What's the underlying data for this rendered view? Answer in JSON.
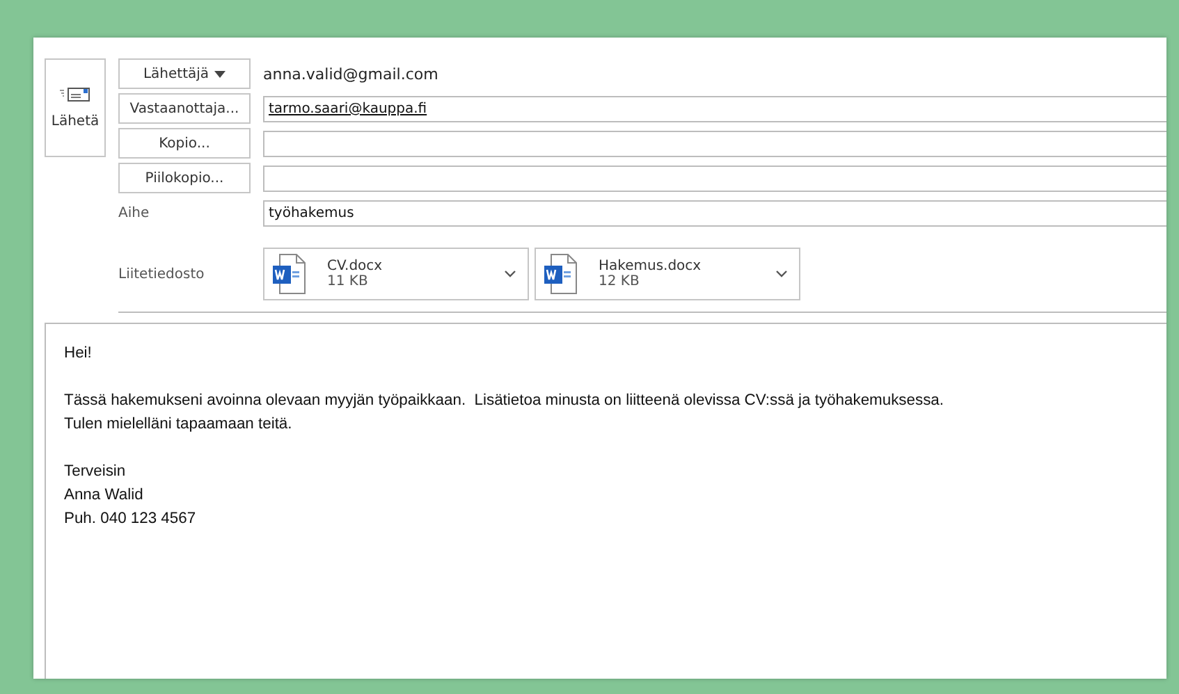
{
  "send_button": {
    "label": "Lähetä"
  },
  "address_rows": [
    {
      "kind": "sender",
      "label": "Lähettäjä",
      "value": "anna.valid@gmail.com"
    },
    {
      "kind": "recipient",
      "label": "Vastaanottaja...",
      "value": "tarmo.saari@kauppa.fi"
    },
    {
      "kind": "recipient",
      "label": "Kopio..."
    },
    {
      "kind": "recipient",
      "label": "Piilokopio..."
    }
  ],
  "subject": {
    "label": "Aihe",
    "value": "työhakemus"
  },
  "attachments": {
    "label": "Liitetiedosto",
    "files": [
      {
        "name": "CV.docx",
        "size": "11 KB"
      },
      {
        "name": "Hakemus.docx",
        "size": "12 KB"
      }
    ]
  },
  "body": {
    "paragraphs": [
      [
        "Hei!"
      ],
      [
        "Tässä hakemukseni avoinna olevaan myyjän työpaikkaan.  Lisätietoa minusta on liitteenä olevissa CV:ssä ja työhakemuksessa.",
        "Tulen mielelläni tapaamaan teitä."
      ],
      [
        "Terveisin",
        "Anna Walid",
        "Puh. 040 123 4567"
      ]
    ]
  }
}
